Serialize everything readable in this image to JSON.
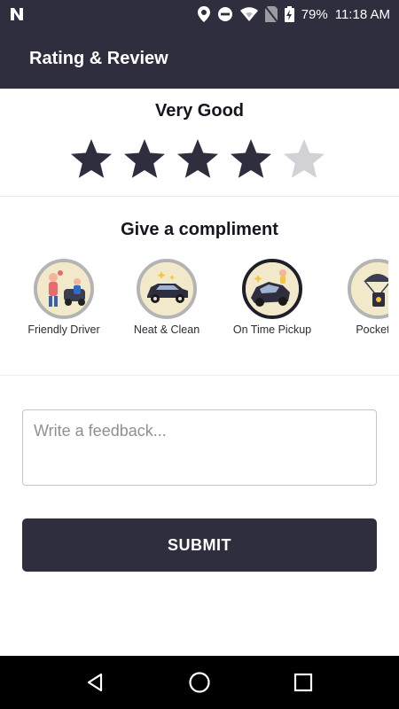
{
  "status_bar": {
    "battery": "79%",
    "time": "11:18 AM",
    "icons": [
      "n-notification-icon",
      "location-icon",
      "do-not-disturb-icon",
      "wifi-icon",
      "no-sim-icon",
      "battery-charging-icon"
    ]
  },
  "app_bar": {
    "title": "Rating & Review"
  },
  "rating": {
    "label": "Very Good",
    "value": 4,
    "max": 5,
    "filled_color": "#2f2e3e",
    "empty_color": "#d1d1d6"
  },
  "compliments": {
    "title": "Give a compliment",
    "items": [
      {
        "label": "Friendly Driver",
        "icon": "friendly-driver-icon"
      },
      {
        "label": "Neat & Clean",
        "icon": "neat-clean-car-icon"
      },
      {
        "label": "On Time Pickup",
        "icon": "on-time-pickup-icon"
      },
      {
        "label": "Pocket F",
        "icon": "pocket-friendly-icon"
      }
    ]
  },
  "feedback": {
    "placeholder": "Write a feedback...",
    "value": ""
  },
  "submit": {
    "label": "SUBMIT"
  },
  "nav_bar": {
    "icons": [
      "back-icon",
      "home-icon",
      "recents-icon"
    ]
  },
  "colors": {
    "primary": "#2f2e3e",
    "badge_bg": "#f1e9c9"
  }
}
